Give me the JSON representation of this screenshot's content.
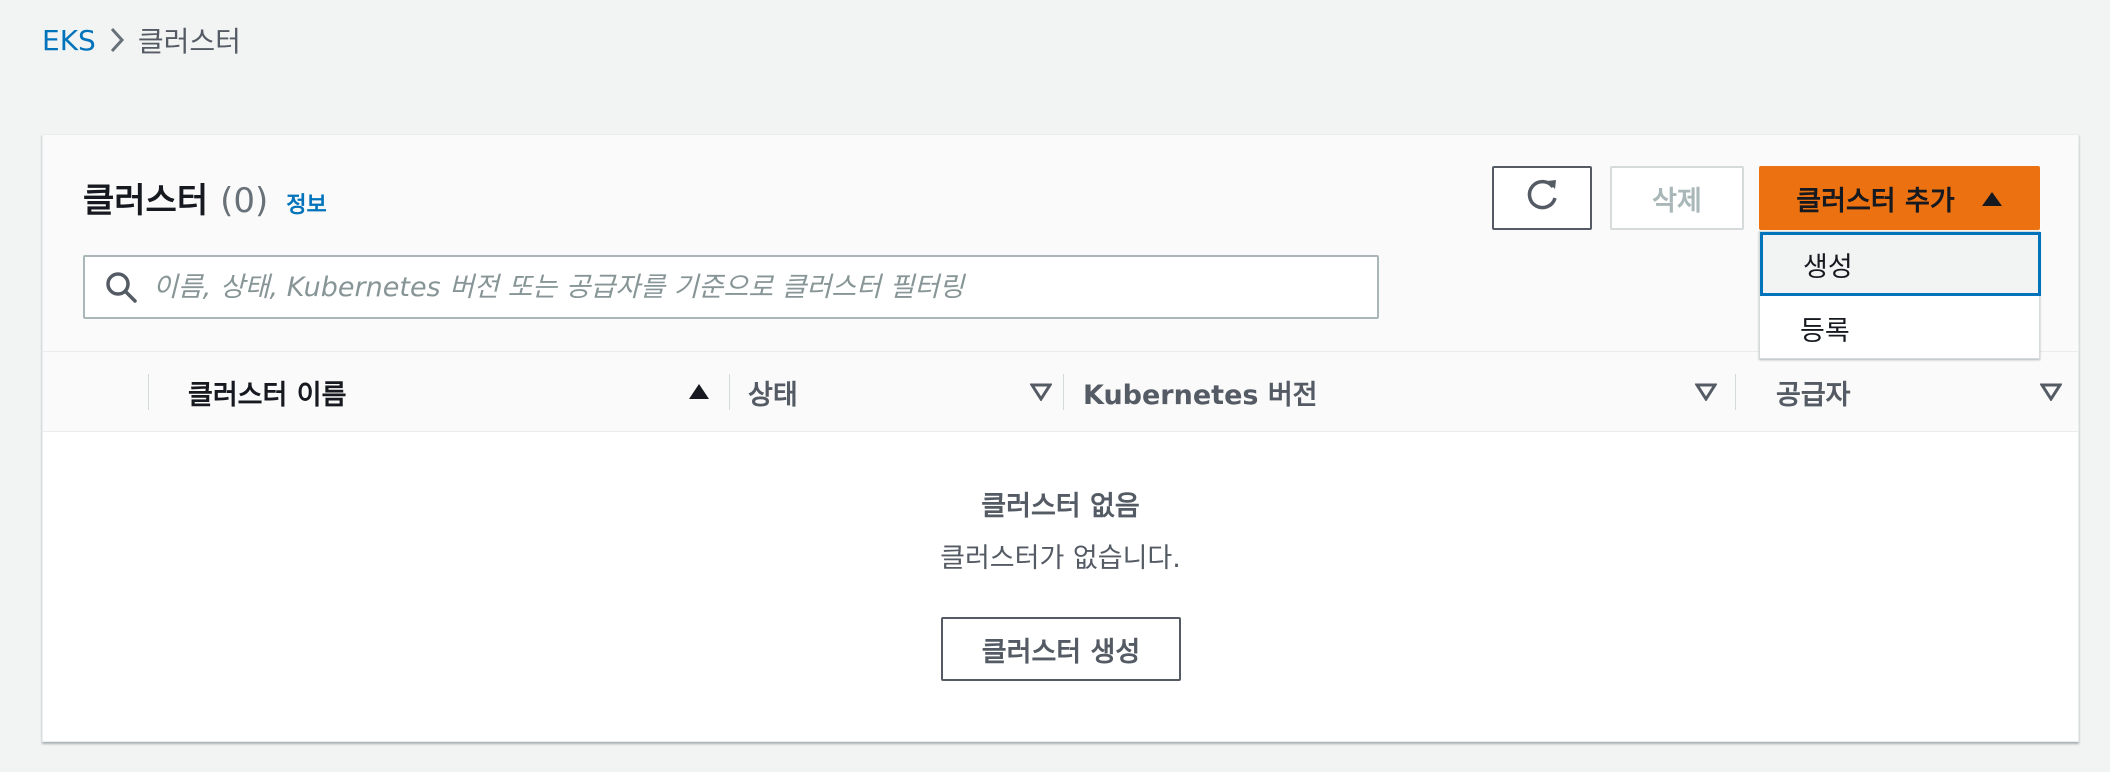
{
  "breadcrumb": {
    "root": "EKS",
    "current": "클러스터"
  },
  "header": {
    "title": "클러스터",
    "count": "(0)",
    "info_link": "정보"
  },
  "search": {
    "placeholder": "이름, 상태, Kubernetes 버전 또는 공급자를 기준으로 클러스터 필터링",
    "value": ""
  },
  "actions": {
    "refresh_icon": "refresh-icon",
    "delete_label": "삭제",
    "add_label": "클러스터 추가",
    "add_caret": "caret-up-icon"
  },
  "add_menu": {
    "items": [
      {
        "label": "생성",
        "highlighted": true
      },
      {
        "label": "등록",
        "highlighted": false
      }
    ]
  },
  "table": {
    "columns": [
      {
        "label": "클러스터 이름",
        "sort": "ascending"
      },
      {
        "label": "상태",
        "sort": "none"
      },
      {
        "label": "Kubernetes 버전",
        "sort": "none"
      },
      {
        "label": "공급자",
        "sort": "none"
      }
    ]
  },
  "empty_state": {
    "title": "클러스터 없음",
    "description": "클러스터가 없습니다.",
    "button_label": "클러스터 생성"
  },
  "colors": {
    "page_bg": "#f2f3f3",
    "link": "#0073bb",
    "primary_button": "#ec7211",
    "focus_border": "#0073bb",
    "disabled_text": "#aab7b8"
  }
}
